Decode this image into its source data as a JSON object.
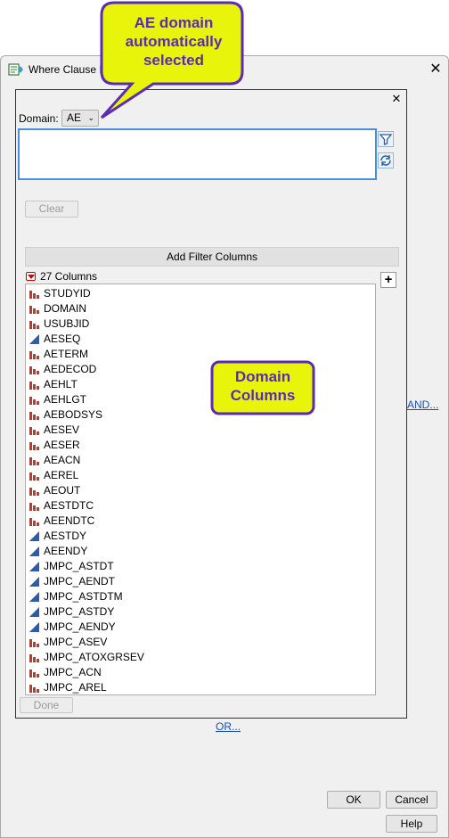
{
  "window": {
    "title": "Where Clause B"
  },
  "domain": {
    "label": "Domain:",
    "value": "AE"
  },
  "buttons": {
    "clear": "Clear",
    "add_filter_columns": "Add Filter Columns",
    "done": "Done",
    "ok": "OK",
    "cancel": "Cancel",
    "help": "Help",
    "plus": "+"
  },
  "columns": {
    "count_label": "27 Columns",
    "items": [
      {
        "name": "STUDYID",
        "type": "nominal"
      },
      {
        "name": "DOMAIN",
        "type": "nominal"
      },
      {
        "name": "USUBJID",
        "type": "nominal"
      },
      {
        "name": "AESEQ",
        "type": "continuous"
      },
      {
        "name": "AETERM",
        "type": "nominal"
      },
      {
        "name": "AEDECOD",
        "type": "nominal"
      },
      {
        "name": "AEHLT",
        "type": "nominal"
      },
      {
        "name": "AEHLGT",
        "type": "nominal"
      },
      {
        "name": "AEBODSYS",
        "type": "nominal"
      },
      {
        "name": "AESEV",
        "type": "nominal"
      },
      {
        "name": "AESER",
        "type": "nominal"
      },
      {
        "name": "AEACN",
        "type": "nominal"
      },
      {
        "name": "AEREL",
        "type": "nominal"
      },
      {
        "name": "AEOUT",
        "type": "nominal"
      },
      {
        "name": "AESTDTC",
        "type": "nominal"
      },
      {
        "name": "AEENDTC",
        "type": "nominal"
      },
      {
        "name": "AESTDY",
        "type": "continuous"
      },
      {
        "name": "AEENDY",
        "type": "continuous"
      },
      {
        "name": "JMPC_ASTDT",
        "type": "continuous"
      },
      {
        "name": "JMPC_AENDT",
        "type": "continuous"
      },
      {
        "name": "JMPC_ASTDTM",
        "type": "continuous"
      },
      {
        "name": "JMPC_ASTDY",
        "type": "continuous"
      },
      {
        "name": "JMPC_AENDY",
        "type": "continuous"
      },
      {
        "name": "JMPC_ASEV",
        "type": "nominal"
      },
      {
        "name": "JMPC_ATOXGRSEV",
        "type": "nominal"
      },
      {
        "name": "JMPC_ACN",
        "type": "nominal"
      },
      {
        "name": "JMPC_AREL",
        "type": "nominal"
      }
    ]
  },
  "links": {
    "and": "AND...",
    "or": "OR..."
  },
  "callouts": {
    "ae_domain": [
      "AE domain",
      "automatically",
      "selected"
    ],
    "domain_columns": [
      "Domain",
      "Columns"
    ]
  },
  "colors": {
    "nominal_icon": "#c0392b",
    "continuous_icon": "#2e5ca8",
    "callout_fill": "#e8f50a",
    "callout_border": "#5b2bb5",
    "focus_border": "#4a90d9",
    "link": "#1a4fb5"
  },
  "icons": {
    "app": "where-clause-app-icon",
    "filter": "filter-funnel-icon",
    "refresh": "refresh-icon",
    "close": "close-icon",
    "dropdown": "chevron-down-icon",
    "disclosure": "disclosure-triangle-icon"
  }
}
